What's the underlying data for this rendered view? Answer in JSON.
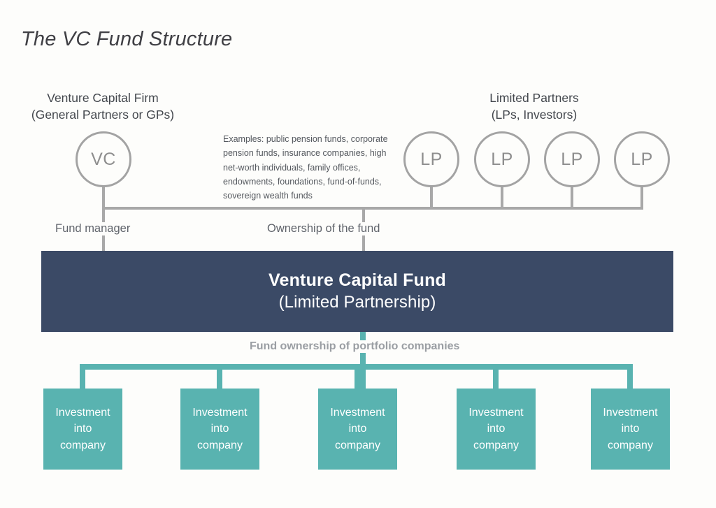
{
  "title": "The VC Fund Structure",
  "colors": {
    "background": "#fdfdfb",
    "fund_box": "#3b4a66",
    "portfolio_box": "#59b3b0",
    "gray_connector": "#a8a8a8",
    "teal_connector": "#59b3b0",
    "circle_stroke": "#a3a3a3",
    "title_text": "#3f3f44"
  },
  "vc_group": {
    "heading_line1": "Venture Capital Firm",
    "heading_line2": "(General Partners or GPs)",
    "node_label": "VC"
  },
  "lp_group": {
    "heading_line1": "Limited Partners",
    "heading_line2": "(LPs, Investors)",
    "nodes": [
      {
        "label": "LP"
      },
      {
        "label": "LP"
      },
      {
        "label": "LP"
      },
      {
        "label": "LP"
      }
    ]
  },
  "examples_note": "Examples: public pension funds, corporate pension funds, insurance companies, high net-worth individuals, family offices, endowments, foundations, fund-of-funds, sovereign wealth funds",
  "edges": {
    "fund_manager": "Fund manager",
    "ownership_of_fund": "Ownership of the fund",
    "portfolio_ownership": "Fund ownership of portfolio companies"
  },
  "fund_box": {
    "line1": "Venture Capital Fund",
    "line2": "(Limited Partnership)"
  },
  "portfolio_boxes": [
    {
      "line1": "Investment",
      "line2": "into",
      "line3": "company"
    },
    {
      "line1": "Investment",
      "line2": "into",
      "line3": "company"
    },
    {
      "line1": "Investment",
      "line2": "into",
      "line3": "company"
    },
    {
      "line1": "Investment",
      "line2": "into",
      "line3": "company"
    },
    {
      "line1": "Investment",
      "line2": "into",
      "line3": "company"
    }
  ]
}
